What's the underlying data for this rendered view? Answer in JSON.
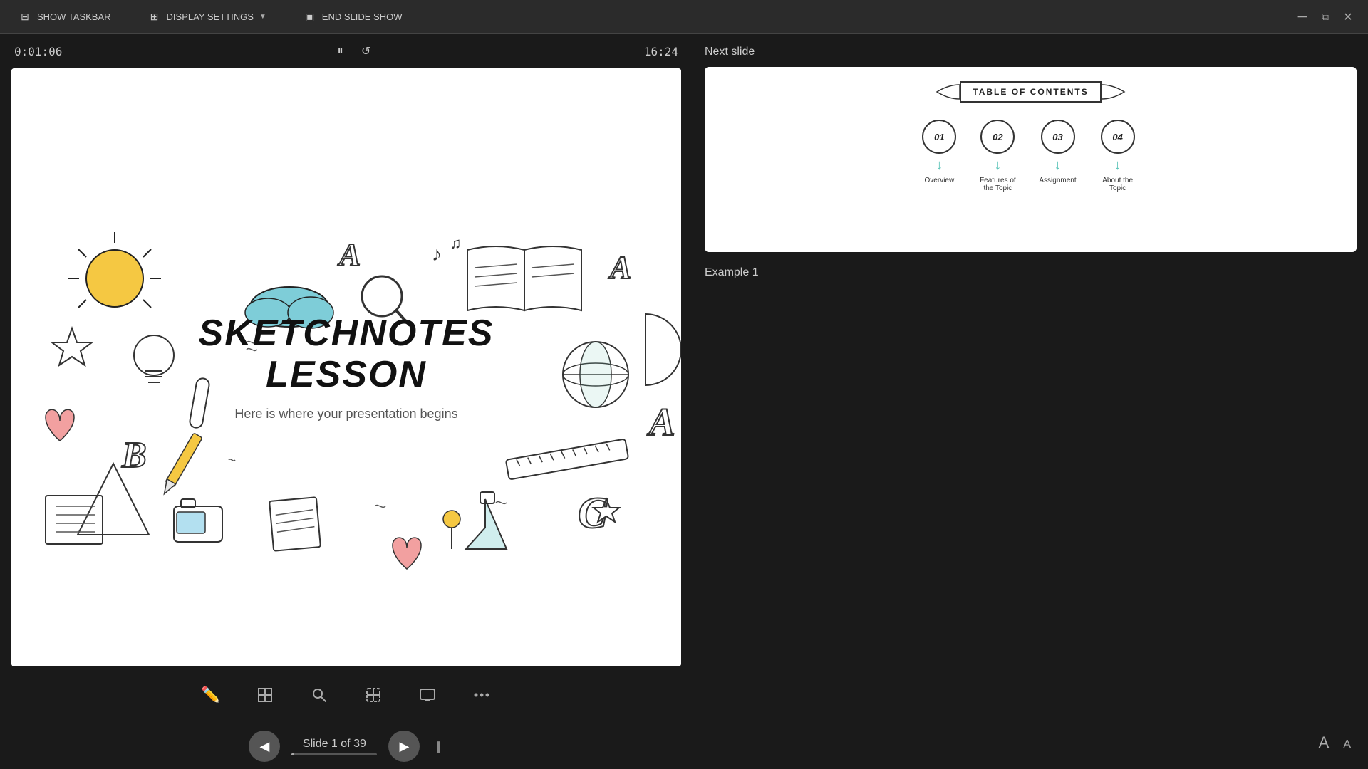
{
  "toolbar": {
    "show_taskbar_label": "SHOW TASKBAR",
    "display_settings_label": "DISPLAY SETTINGS",
    "end_slideshow_label": "END SLIDE SHOW"
  },
  "slide_header": {
    "timer": "0:01:06",
    "clock": "16:24"
  },
  "slide": {
    "title_line1": "SKETCHNOTES",
    "title_line2": "LESSON",
    "subtitle": "Here is where your presentation begins"
  },
  "navigation": {
    "slide_indicator": "Slide 1 of 39",
    "current": 1,
    "total": 39
  },
  "bottom_tools": {
    "pen": "✏",
    "grid": "⊞",
    "search": "🔍",
    "pointer": "⊡",
    "screen": "▭",
    "more": "···"
  },
  "right_panel": {
    "next_slide_label": "Next slide",
    "example_label": "Example 1",
    "preview": {
      "banner_text": "TABLE OF CONTENTS",
      "items": [
        {
          "number": "01",
          "label": "Overview"
        },
        {
          "number": "02",
          "label": "Features of the Topic"
        },
        {
          "number": "03",
          "label": "Assignment"
        },
        {
          "number": "04",
          "label": "About the Topic"
        }
      ]
    }
  },
  "icons": {
    "pause": "⏸",
    "reset": "↺",
    "prev_nav": "◀",
    "next_nav": "▶",
    "text_size_large": "A",
    "text_size_small": "A"
  }
}
